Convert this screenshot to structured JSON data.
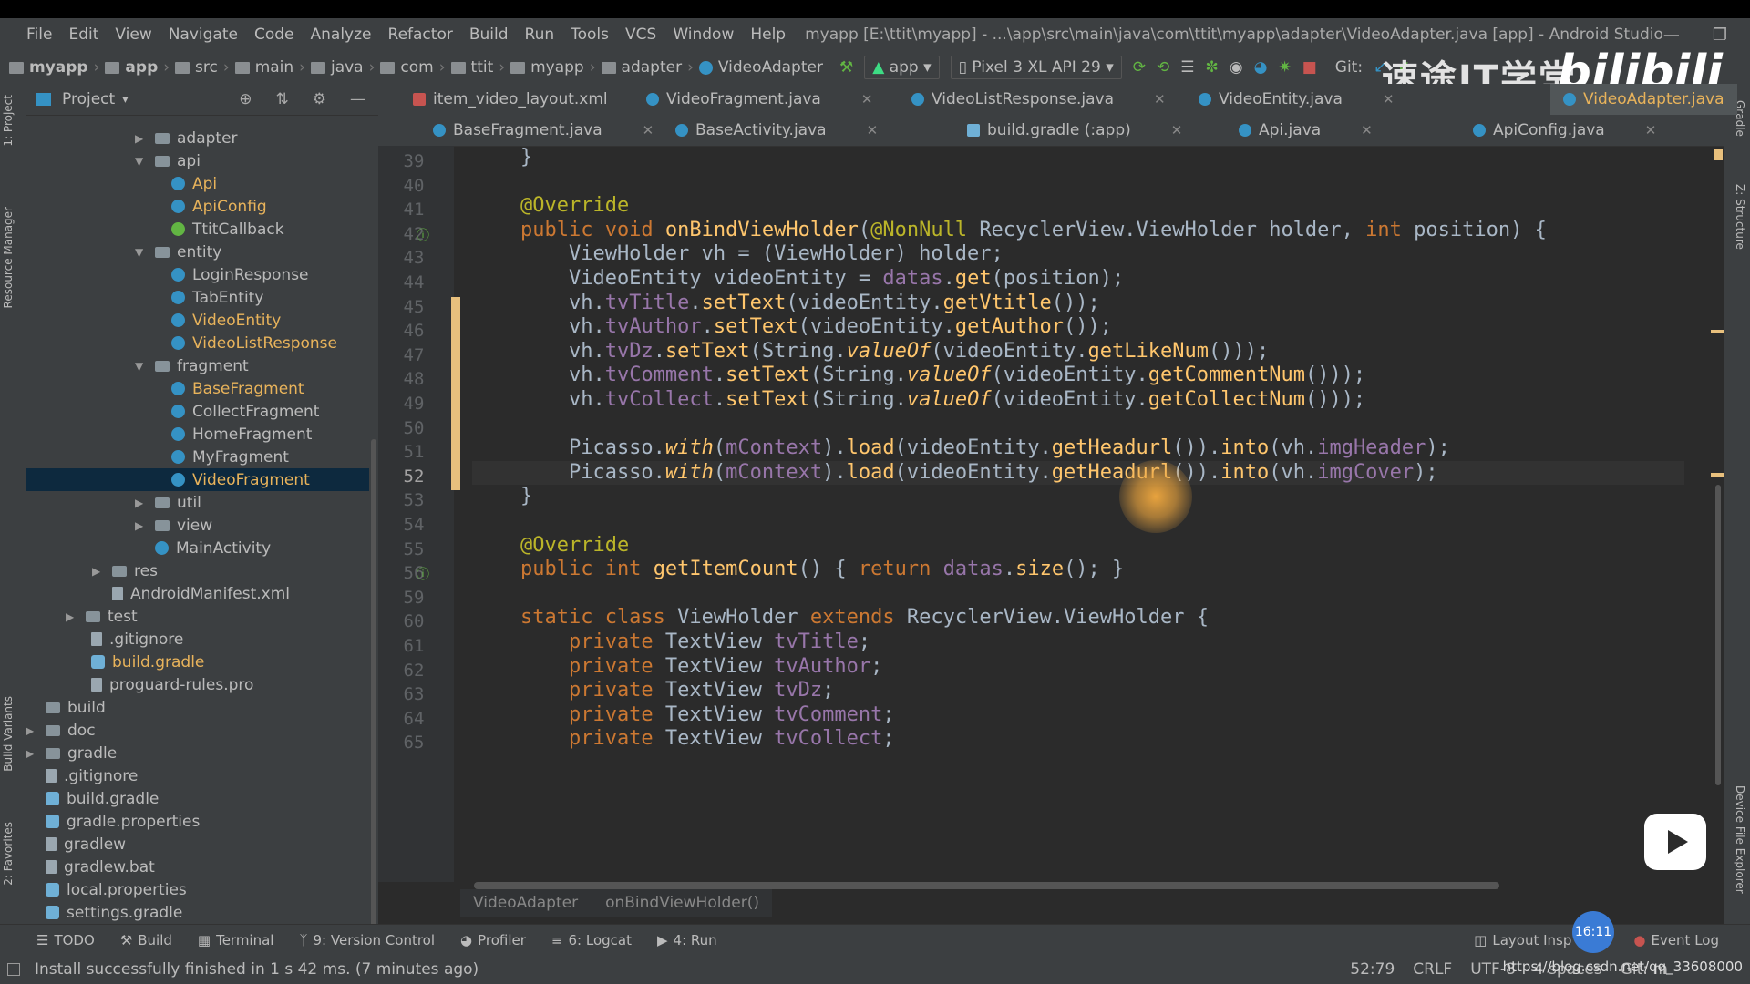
{
  "window": {
    "title": "myapp [E:\\ttit\\myapp] - ...\\app\\src\\main\\java\\com\\ttit\\myapp\\adapter\\VideoAdapter.java [app] - Android Studio",
    "controls": [
      "—",
      "❐",
      "✕"
    ]
  },
  "menu": [
    "File",
    "Edit",
    "View",
    "Navigate",
    "Code",
    "Analyze",
    "Refactor",
    "Build",
    "Run",
    "Tools",
    "VCS",
    "Window",
    "Help"
  ],
  "breadcrumbs": [
    "myapp",
    "app",
    "src",
    "main",
    "java",
    "com",
    "ttit",
    "myapp",
    "adapter",
    "VideoAdapter"
  ],
  "toolbar": {
    "run_config": "app",
    "device": "Pixel 3 XL API 29",
    "git_label": "Git:"
  },
  "project_panel": {
    "title": "Project",
    "tree": [
      {
        "label": "adapter",
        "type": "folder",
        "arrow": "▶"
      },
      {
        "label": "api",
        "type": "folder",
        "arrow": "▼"
      },
      {
        "label": "Api",
        "type": "class",
        "modified": true
      },
      {
        "label": "ApiConfig",
        "type": "class",
        "modified": true
      },
      {
        "label": "TtitCallback",
        "type": "interface"
      },
      {
        "label": "entity",
        "type": "folder",
        "arrow": "▼"
      },
      {
        "label": "LoginResponse",
        "type": "class"
      },
      {
        "label": "TabEntity",
        "type": "class"
      },
      {
        "label": "VideoEntity",
        "type": "class",
        "modified": true
      },
      {
        "label": "VideoListResponse",
        "type": "class",
        "modified": true
      },
      {
        "label": "fragment",
        "type": "folder",
        "arrow": "▼"
      },
      {
        "label": "BaseFragment",
        "type": "class",
        "modified": true
      },
      {
        "label": "CollectFragment",
        "type": "class"
      },
      {
        "label": "HomeFragment",
        "type": "class"
      },
      {
        "label": "MyFragment",
        "type": "class"
      },
      {
        "label": "VideoFragment",
        "type": "class",
        "modified": true,
        "selected": true
      },
      {
        "label": "util",
        "type": "folder",
        "arrow": "▶"
      },
      {
        "label": "view",
        "type": "folder",
        "arrow": "▶"
      },
      {
        "label": "MainActivity",
        "type": "class"
      },
      {
        "label": "res",
        "type": "folder",
        "arrow": "▶"
      },
      {
        "label": "AndroidManifest.xml",
        "type": "file"
      },
      {
        "label": "test",
        "type": "folder",
        "arrow": "▶"
      },
      {
        "label": ".gitignore",
        "type": "file"
      },
      {
        "label": "build.gradle",
        "type": "gradle",
        "modified": true
      },
      {
        "label": "proguard-rules.pro",
        "type": "file"
      },
      {
        "label": "build",
        "type": "folder"
      },
      {
        "label": "doc",
        "type": "folder",
        "arrow": "▶"
      },
      {
        "label": "gradle",
        "type": "folder",
        "arrow": "▶"
      },
      {
        "label": ".gitignore",
        "type": "file"
      },
      {
        "label": "build.gradle",
        "type": "gradle"
      },
      {
        "label": "gradle.properties",
        "type": "gradle"
      },
      {
        "label": "gradlew",
        "type": "file"
      },
      {
        "label": "gradlew.bat",
        "type": "file"
      },
      {
        "label": "local.properties",
        "type": "gradle"
      },
      {
        "label": "settings.gradle",
        "type": "gradle"
      }
    ]
  },
  "left_strip_tabs": [
    "1: Project",
    "Resource Manager",
    "Build Variants",
    "2: Favorites"
  ],
  "right_strip_tabs": [
    "Gradle",
    "Z: Structure",
    "Device File Explorer"
  ],
  "tabs_row1": [
    {
      "label": "item_video_layout.xml",
      "icon": "xml"
    },
    {
      "label": "VideoFragment.java",
      "icon": "class"
    },
    {
      "label": "VideoListResponse.java",
      "icon": "class"
    },
    {
      "label": "VideoEntity.java",
      "icon": "class"
    },
    {
      "label": "VideoAdapter.java",
      "icon": "class",
      "active": true
    }
  ],
  "tabs_row2": [
    {
      "label": "BaseFragment.java",
      "icon": "class"
    },
    {
      "label": "BaseActivity.java",
      "icon": "class"
    },
    {
      "label": "build.gradle (:app)",
      "icon": "gradle"
    },
    {
      "label": "Api.java",
      "icon": "class"
    },
    {
      "label": "ApiConfig.java",
      "icon": "class"
    }
  ],
  "line_numbers": [
    "39",
    "40",
    "41",
    "42",
    "43",
    "44",
    "45",
    "46",
    "47",
    "48",
    "49",
    "50",
    "51",
    "52",
    "53",
    "54",
    "55",
    "56",
    "59",
    "60",
    "61",
    "62",
    "63",
    "64",
    "65"
  ],
  "code_lines": [
    [
      {
        "c": "pl",
        "t": "    }"
      }
    ],
    [],
    [
      {
        "c": "an",
        "t": "    @Override"
      }
    ],
    [
      {
        "c": "kw",
        "t": "    public void "
      },
      {
        "c": "fn",
        "t": "onBindViewHolder"
      },
      {
        "c": "pl",
        "t": "("
      },
      {
        "c": "an",
        "t": "@NonNull "
      },
      {
        "c": "pl",
        "t": "RecyclerView.ViewHolder holder, "
      },
      {
        "c": "kw",
        "t": "int "
      },
      {
        "c": "pl",
        "t": "position) {"
      }
    ],
    [
      {
        "c": "pl",
        "t": "        ViewHolder vh = (ViewHolder) holder;"
      }
    ],
    [
      {
        "c": "pl",
        "t": "        VideoEntity videoEntity = "
      },
      {
        "c": "fld",
        "t": "datas"
      },
      {
        "c": "pl",
        "t": "."
      },
      {
        "c": "mc",
        "t": "get"
      },
      {
        "c": "pl",
        "t": "(position);"
      }
    ],
    [
      {
        "c": "pl",
        "t": "        vh."
      },
      {
        "c": "fld",
        "t": "tvTitle"
      },
      {
        "c": "pl",
        "t": "."
      },
      {
        "c": "mc",
        "t": "setText"
      },
      {
        "c": "pl",
        "t": "(videoEntity."
      },
      {
        "c": "mc",
        "t": "getVtitle"
      },
      {
        "c": "pl",
        "t": "());"
      }
    ],
    [
      {
        "c": "pl",
        "t": "        vh."
      },
      {
        "c": "fld",
        "t": "tvAuthor"
      },
      {
        "c": "pl",
        "t": "."
      },
      {
        "c": "mc",
        "t": "setText"
      },
      {
        "c": "pl",
        "t": "(videoEntity."
      },
      {
        "c": "mc",
        "t": "getAuthor"
      },
      {
        "c": "pl",
        "t": "());"
      }
    ],
    [
      {
        "c": "pl",
        "t": "        vh."
      },
      {
        "c": "fld",
        "t": "tvDz"
      },
      {
        "c": "pl",
        "t": "."
      },
      {
        "c": "mc",
        "t": "setText"
      },
      {
        "c": "pl",
        "t": "(String."
      },
      {
        "c": "st",
        "t": "valueOf"
      },
      {
        "c": "pl",
        "t": "(videoEntity."
      },
      {
        "c": "mc",
        "t": "getLikeNum"
      },
      {
        "c": "pl",
        "t": "()));"
      }
    ],
    [
      {
        "c": "pl",
        "t": "        vh."
      },
      {
        "c": "fld",
        "t": "tvComment"
      },
      {
        "c": "pl",
        "t": "."
      },
      {
        "c": "mc",
        "t": "setText"
      },
      {
        "c": "pl",
        "t": "(String."
      },
      {
        "c": "st",
        "t": "valueOf"
      },
      {
        "c": "pl",
        "t": "(videoEntity."
      },
      {
        "c": "mc",
        "t": "getCommentNum"
      },
      {
        "c": "pl",
        "t": "()));"
      }
    ],
    [
      {
        "c": "pl",
        "t": "        vh."
      },
      {
        "c": "fld",
        "t": "tvCollect"
      },
      {
        "c": "pl",
        "t": "."
      },
      {
        "c": "mc",
        "t": "setText"
      },
      {
        "c": "pl",
        "t": "(String."
      },
      {
        "c": "st",
        "t": "valueOf"
      },
      {
        "c": "pl",
        "t": "(videoEntity."
      },
      {
        "c": "mc",
        "t": "getCollectNum"
      },
      {
        "c": "pl",
        "t": "()));"
      }
    ],
    [],
    [
      {
        "c": "pl",
        "t": "        Picasso."
      },
      {
        "c": "st",
        "t": "with"
      },
      {
        "c": "pl",
        "t": "("
      },
      {
        "c": "fld",
        "t": "mContext"
      },
      {
        "c": "pl",
        "t": ")."
      },
      {
        "c": "mc",
        "t": "load"
      },
      {
        "c": "pl",
        "t": "(videoEntity."
      },
      {
        "c": "mc",
        "t": "getHeadurl"
      },
      {
        "c": "pl",
        "t": "())."
      },
      {
        "c": "mc",
        "t": "into"
      },
      {
        "c": "pl",
        "t": "(vh."
      },
      {
        "c": "fld",
        "t": "imgHeader"
      },
      {
        "c": "pl",
        "t": ");"
      }
    ],
    [
      {
        "c": "pl",
        "t": "        Picasso."
      },
      {
        "c": "st",
        "t": "with"
      },
      {
        "c": "pl",
        "t": "("
      },
      {
        "c": "fld",
        "t": "mContext"
      },
      {
        "c": "pl",
        "t": ")."
      },
      {
        "c": "mc",
        "t": "load"
      },
      {
        "c": "pl",
        "t": "(videoEntity."
      },
      {
        "c": "mc",
        "t": "getHeadurl"
      },
      {
        "c": "pl",
        "t": "())."
      },
      {
        "c": "mc",
        "t": "into"
      },
      {
        "c": "pl",
        "t": "(vh."
      },
      {
        "c": "fld",
        "t": "imgCover"
      },
      {
        "c": "pl",
        "t": ");"
      }
    ],
    [
      {
        "c": "pl",
        "t": "    }"
      }
    ],
    [],
    [
      {
        "c": "an",
        "t": "    @Override"
      }
    ],
    [
      {
        "c": "kw",
        "t": "    public int "
      },
      {
        "c": "fn",
        "t": "getItemCount"
      },
      {
        "c": "pl",
        "t": "() { "
      },
      {
        "c": "kw",
        "t": "return "
      },
      {
        "c": "fld",
        "t": "datas"
      },
      {
        "c": "pl",
        "t": "."
      },
      {
        "c": "mc",
        "t": "size"
      },
      {
        "c": "pl",
        "t": "(); }"
      }
    ],
    [],
    [
      {
        "c": "kw",
        "t": "    static class "
      },
      {
        "c": "pl",
        "t": "ViewHolder "
      },
      {
        "c": "kw",
        "t": "extends "
      },
      {
        "c": "pl",
        "t": "RecyclerView.ViewHolder {"
      }
    ],
    [
      {
        "c": "kw",
        "t": "        private "
      },
      {
        "c": "pl",
        "t": "TextView "
      },
      {
        "c": "fld",
        "t": "tvTitle"
      },
      {
        "c": "pl",
        "t": ";"
      }
    ],
    [
      {
        "c": "kw",
        "t": "        private "
      },
      {
        "c": "pl",
        "t": "TextView "
      },
      {
        "c": "fld",
        "t": "tvAuthor"
      },
      {
        "c": "pl",
        "t": ";"
      }
    ],
    [
      {
        "c": "kw",
        "t": "        private "
      },
      {
        "c": "pl",
        "t": "TextView "
      },
      {
        "c": "fld",
        "t": "tvDz"
      },
      {
        "c": "pl",
        "t": ";"
      }
    ],
    [
      {
        "c": "kw",
        "t": "        private "
      },
      {
        "c": "pl",
        "t": "TextView "
      },
      {
        "c": "fld",
        "t": "tvComment"
      },
      {
        "c": "pl",
        "t": ";"
      }
    ],
    [
      {
        "c": "kw",
        "t": "        private "
      },
      {
        "c": "pl",
        "t": "TextView "
      },
      {
        "c": "fld",
        "t": "tvCollect"
      },
      {
        "c": "pl",
        "t": ";"
      }
    ]
  ],
  "current_line_index": 13,
  "editor_breadcrumb": [
    "VideoAdapter",
    "onBindViewHolder()"
  ],
  "bottom_tools": [
    "TODO",
    "Build",
    "Terminal",
    "9: Version Control",
    "Profiler",
    "6: Logcat",
    "4: Run"
  ],
  "bottom_right_tools": [
    "Layout Insp",
    "Event Log"
  ],
  "status": {
    "message": "Install successfully finished in 1 s 42 ms. (7 minutes ago)",
    "position": "52:79",
    "line_sep": "CRLF",
    "encoding": "UTF-8",
    "indent": "4 spaces",
    "git": "Git: m"
  },
  "overlay": {
    "watermark_cn": "速途IT学堂",
    "watermark_bili": "bilibili",
    "clock": "16:11",
    "url": "https://blog.csdn.net/qq_33608000"
  },
  "colors": {
    "keyword": "#cc7832",
    "annotation": "#bbb529",
    "method": "#ffc66d",
    "field": "#9876aa",
    "text": "#a9b7c6",
    "modified_file": "#e8b35b",
    "class_icon": "#3592c4"
  }
}
